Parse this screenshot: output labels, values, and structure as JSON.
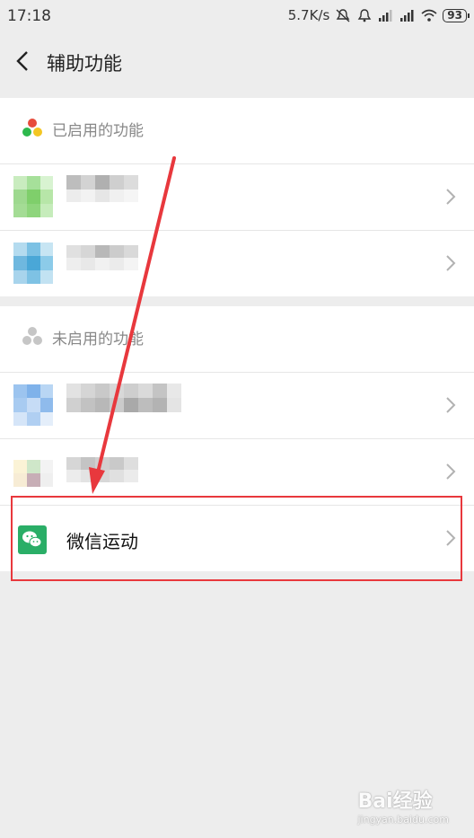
{
  "status_bar": {
    "time": "17:18",
    "network_speed": "5.7K/s",
    "battery": "93",
    "icons": [
      "mute-bell-icon",
      "alarm-icon",
      "signal-icon",
      "signal-icon",
      "wifi-icon",
      "battery-icon"
    ]
  },
  "nav": {
    "title": "辅助功能",
    "back_icon": "back-chevron-icon"
  },
  "enabled_section": {
    "title": "已启用的功能",
    "icon": "three-dots-color-icon"
  },
  "disabled_section": {
    "title": "未启用的功能",
    "icon": "three-dots-gray-icon"
  },
  "highlighted_item": {
    "label": "微信运动",
    "icon": "wechat-icon"
  },
  "watermark": {
    "brand": "Bai经验",
    "url": "jingyan.baidu.com"
  },
  "colors": {
    "accent_red": "#e8383d",
    "wechat_green": "#2aae67",
    "background": "#ededed"
  }
}
